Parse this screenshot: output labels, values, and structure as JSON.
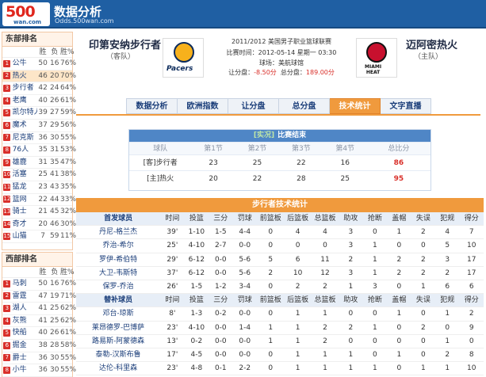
{
  "header": {
    "logo_number": "500",
    "logo_domain": "wan.com",
    "title": "数据分析",
    "url": "Odds.500wan.com"
  },
  "east": {
    "title": "东部排名",
    "columns": [
      "",
      "胜",
      "负",
      "胜%"
    ],
    "rows": [
      {
        "rank": "1",
        "team": "公牛",
        "w": "50",
        "l": "16",
        "pct": "76%"
      },
      {
        "rank": "2",
        "team": "热火",
        "w": "46",
        "l": "20",
        "pct": "70%"
      },
      {
        "rank": "3",
        "team": "步行者",
        "w": "42",
        "l": "24",
        "pct": "64%"
      },
      {
        "rank": "4",
        "team": "老鹰",
        "w": "40",
        "l": "26",
        "pct": "61%"
      },
      {
        "rank": "5",
        "team": "凯尔特人",
        "w": "39",
        "l": "27",
        "pct": "59%"
      },
      {
        "rank": "6",
        "team": "魔术",
        "w": "37",
        "l": "29",
        "pct": "56%"
      },
      {
        "rank": "7",
        "team": "尼克斯",
        "w": "36",
        "l": "30",
        "pct": "55%"
      },
      {
        "rank": "8",
        "team": "76人",
        "w": "35",
        "l": "31",
        "pct": "53%"
      },
      {
        "rank": "9",
        "team": "雄鹿",
        "w": "31",
        "l": "35",
        "pct": "47%"
      },
      {
        "rank": "10",
        "team": "活塞",
        "w": "25",
        "l": "41",
        "pct": "38%"
      },
      {
        "rank": "11",
        "team": "猛龙",
        "w": "23",
        "l": "43",
        "pct": "35%"
      },
      {
        "rank": "12",
        "team": "篮网",
        "w": "22",
        "l": "44",
        "pct": "33%"
      },
      {
        "rank": "13",
        "team": "骑士",
        "w": "21",
        "l": "45",
        "pct": "32%"
      },
      {
        "rank": "14",
        "team": "奇才",
        "w": "20",
        "l": "46",
        "pct": "30%"
      },
      {
        "rank": "15",
        "team": "山猫",
        "w": "7",
        "l": "59",
        "pct": "11%"
      }
    ]
  },
  "west": {
    "title": "西部排名",
    "columns": [
      "",
      "胜",
      "负",
      "胜%"
    ],
    "rows": [
      {
        "rank": "1",
        "team": "马刺",
        "w": "50",
        "l": "16",
        "pct": "76%"
      },
      {
        "rank": "2",
        "team": "雷霆",
        "w": "47",
        "l": "19",
        "pct": "71%"
      },
      {
        "rank": "3",
        "team": "湖人",
        "w": "41",
        "l": "25",
        "pct": "62%"
      },
      {
        "rank": "4",
        "team": "灰熊",
        "w": "41",
        "l": "25",
        "pct": "62%"
      },
      {
        "rank": "5",
        "team": "快船",
        "w": "40",
        "l": "26",
        "pct": "61%"
      },
      {
        "rank": "6",
        "team": "掘金",
        "w": "38",
        "l": "28",
        "pct": "58%"
      },
      {
        "rank": "7",
        "team": "爵士",
        "w": "36",
        "l": "30",
        "pct": "55%"
      },
      {
        "rank": "8",
        "team": "小牛",
        "w": "36",
        "l": "30",
        "pct": "55%"
      }
    ]
  },
  "match": {
    "away_name": "印第安纳步行者",
    "away_tag": "（客队）",
    "home_name": "迈阿密热火",
    "home_tag": "（主队）",
    "away_logo_text": "Pacers",
    "home_logo_text_1": "MIAMI",
    "home_logo_text_2": "HEAT",
    "league": "2011/2012  美国男子职业篮球联赛",
    "time": "比赛时间：2012-05-14 星期一 03:30",
    "venue": "球场：美航球馆",
    "handicap_label": "让分盘：",
    "handicap": "-8.50分",
    "total_label": "总分盘：",
    "total": "189.00分"
  },
  "tabs": [
    "数据分析",
    "欧洲指数",
    "让分盘",
    "总分盘",
    "技术统计",
    "文字直播"
  ],
  "quarters": {
    "tag": "[实况]",
    "title": "比赛结束",
    "columns": [
      "球队",
      "第1节",
      "第2节",
      "第3节",
      "第4节",
      "总比分"
    ],
    "rows": [
      {
        "team": "[客]步行者",
        "q1": "23",
        "q2": "25",
        "q3": "22",
        "q4": "16",
        "total": "86"
      },
      {
        "team": "[主]热火",
        "q1": "20",
        "q2": "22",
        "q3": "28",
        "q4": "25",
        "total": "95"
      }
    ]
  },
  "stats": {
    "title": "步行者技术统计",
    "columns": [
      "时间",
      "投篮",
      "三分",
      "罚球",
      "前篮板",
      "后篮板",
      "总篮板",
      "助攻",
      "抢断",
      "盖帽",
      "失误",
      "犯规",
      "得分"
    ],
    "starters_label": "首发球员",
    "bench_label": "替补球员",
    "starters": [
      {
        "name": "丹尼-格兰杰",
        "v": [
          "39'",
          "1-10",
          "1-5",
          "4-4",
          "0",
          "4",
          "4",
          "3",
          "0",
          "1",
          "2",
          "4",
          "7"
        ]
      },
      {
        "name": "乔治-希尔",
        "v": [
          "25'",
          "4-10",
          "2-7",
          "0-0",
          "0",
          "0",
          "0",
          "3",
          "1",
          "0",
          "0",
          "5",
          "10"
        ]
      },
      {
        "name": "罗伊-希伯特",
        "v": [
          "29'",
          "6-12",
          "0-0",
          "5-6",
          "5",
          "6",
          "11",
          "2",
          "1",
          "2",
          "2",
          "3",
          "17"
        ]
      },
      {
        "name": "大卫-韦斯特",
        "v": [
          "37'",
          "6-12",
          "0-0",
          "5-6",
          "2",
          "10",
          "12",
          "3",
          "1",
          "2",
          "2",
          "2",
          "17"
        ]
      },
      {
        "name": "保罗-乔治",
        "v": [
          "26'",
          "1-5",
          "1-2",
          "3-4",
          "0",
          "2",
          "2",
          "1",
          "3",
          "0",
          "1",
          "6",
          "6"
        ]
      }
    ],
    "bench": [
      {
        "name": "邓台-琼斯",
        "v": [
          "8'",
          "1-3",
          "0-2",
          "0-0",
          "0",
          "1",
          "1",
          "0",
          "0",
          "1",
          "0",
          "1",
          "2"
        ]
      },
      {
        "name": "莱昂德罗-巴博萨",
        "v": [
          "23'",
          "4-10",
          "0-0",
          "1-4",
          "1",
          "1",
          "2",
          "2",
          "1",
          "0",
          "2",
          "0",
          "9"
        ]
      },
      {
        "name": "路易斯-阿蒙德森",
        "v": [
          "13'",
          "0-2",
          "0-0",
          "0-0",
          "1",
          "1",
          "2",
          "0",
          "0",
          "0",
          "0",
          "1",
          "0"
        ]
      },
      {
        "name": "泰勒-汉斯布鲁",
        "v": [
          "17'",
          "4-5",
          "0-0",
          "0-0",
          "0",
          "1",
          "1",
          "1",
          "0",
          "1",
          "0",
          "2",
          "8"
        ]
      },
      {
        "name": "达伦-科里森",
        "v": [
          "23'",
          "4-8",
          "0-1",
          "2-2",
          "0",
          "1",
          "1",
          "1",
          "1",
          "0",
          "1",
          "1",
          "10"
        ]
      }
    ]
  }
}
